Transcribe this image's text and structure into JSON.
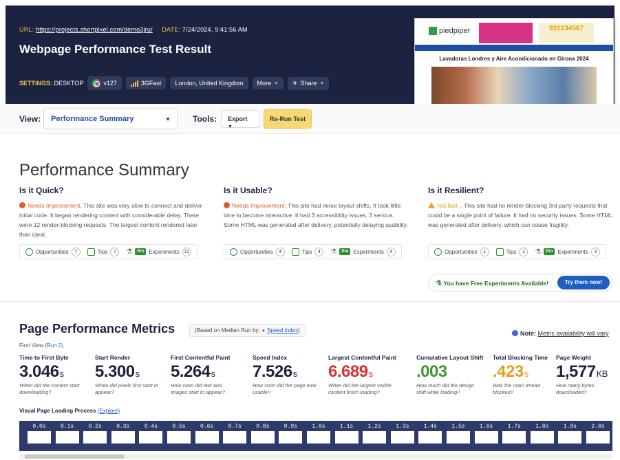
{
  "header": {
    "url_label": "URL:",
    "url": "https://projects.shortpixel.com/demo3jru/",
    "date_label": "DATE:",
    "date": "7/24/2024, 9:41:56 AM",
    "title": "Webpage Performance Test Result",
    "settings_label": "SETTINGS:",
    "settings_device": "DESKTOP",
    "browser_version": "v127",
    "connection": "3GFast",
    "location": "London, United Kingdom",
    "more_label": "More",
    "share_label": "Share"
  },
  "thumbnail": {
    "site_name": "piedpiper",
    "phone": "931234567",
    "headline": "Lavadoras Londres y Aire Acondicionado en Girona 2024"
  },
  "toolbar": {
    "view_label": "View:",
    "view_selected": "Performance Summary",
    "tools_label": "Tools:",
    "export_label": "Export",
    "rerun_label": "Re-Run Test"
  },
  "summary": {
    "title": "Performance Summary",
    "columns": [
      {
        "heading": "Is it Quick?",
        "status": "Needs Improvement.",
        "text": "This site was very slow to connect and deliver initial code. It began rendering content with considerable delay. There were 12 render-blocking requests. The largest content rendered later than ideal.",
        "opportunities_label": "Opportunities",
        "opportunities": "7",
        "tips_label": "Tips",
        "tips": "7",
        "experiments_label": "Experiments",
        "experiments": "11",
        "pro": "Pro"
      },
      {
        "heading": "Is it Usable?",
        "status": "Needs Improvement.",
        "text": "This site had minor layout shifts. It took little time to become interactive. It had 3 accessibility issues, 3 serious. Some HTML was generated after delivery, potentially delaying usability.",
        "opportunities_label": "Opportunities",
        "opportunities": "4",
        "tips_label": "Tips",
        "tips": "4",
        "experiments_label": "Experiments",
        "experiments": "4",
        "pro": "Pro"
      },
      {
        "heading": "Is it Resilient?",
        "status": "Not bad...",
        "text": "This site had no render-blocking 3rd party requests that could be a single point of failure. It had no security issues. Some HTML was generated after delivery, which can cause fragility.",
        "opportunities_label": "Opportunities",
        "opportunities": "1",
        "tips_label": "Tips",
        "tips": "1",
        "experiments_label": "Experiments",
        "experiments": "3",
        "pro": "Pro"
      }
    ],
    "free_experiments": "You have Free Experiments Available!",
    "try_label": "Try them now!"
  },
  "metrics": {
    "title": "Page Performance Metrics",
    "median_prefix": "(Based on Median Run by:",
    "median_link": "Speed Index",
    "median_suffix": ")",
    "note_label": "Note:",
    "note_text": "Metric availability will vary",
    "first_view": "First View",
    "run_link": "(Run 2)",
    "items": [
      {
        "label": "Time to First Byte",
        "value": "3.046",
        "unit": "s",
        "desc": "When did the content start downloading?",
        "color": "#1c2340"
      },
      {
        "label": "Start Render",
        "value": "5.300",
        "unit": "s",
        "desc": "When did pixels first start to appear?",
        "color": "#1c2340"
      },
      {
        "label": "First Contentful Paint",
        "value": "5.264",
        "unit": "s",
        "desc": "How soon did text and images start to appear?",
        "color": "#1c2340"
      },
      {
        "label": "Speed Index",
        "value": "7.526",
        "unit": "s",
        "desc": "How soon did the page look usable?",
        "color": "#1c2340"
      },
      {
        "label": "Largest Contentful Paint",
        "value": "6.689",
        "unit": "s",
        "desc": "When did the largest visible content finish loading?",
        "color": "#d63333"
      },
      {
        "label": "Cumulative Layout Shift",
        "value": ".003",
        "unit": "",
        "desc": "How much did the design shift while loading?",
        "color": "#3a9a2a"
      },
      {
        "label": "Total Blocking Time",
        "value": ".423",
        "unit": "s",
        "desc": "Was the main thread blocked?",
        "color": "#e8a020"
      },
      {
        "label": "Page Weight",
        "value": "1,577",
        "unit": "KB",
        "desc": "How many bytes downloaded?",
        "color": "#1c2340"
      }
    ],
    "visual_label": "Visual Page Loading Process",
    "explore_link": "(Explore)",
    "frames": [
      "0.0s",
      "0.1s",
      "0.2s",
      "0.3s",
      "0.4s",
      "0.5s",
      "0.6s",
      "0.7s",
      "0.8s",
      "0.9s",
      "1.0s",
      "1.1s",
      "1.2s",
      "1.3s",
      "1.4s",
      "1.5s",
      "1.6s",
      "1.7s",
      "1.8s",
      "1.9s",
      "2.0s"
    ]
  }
}
